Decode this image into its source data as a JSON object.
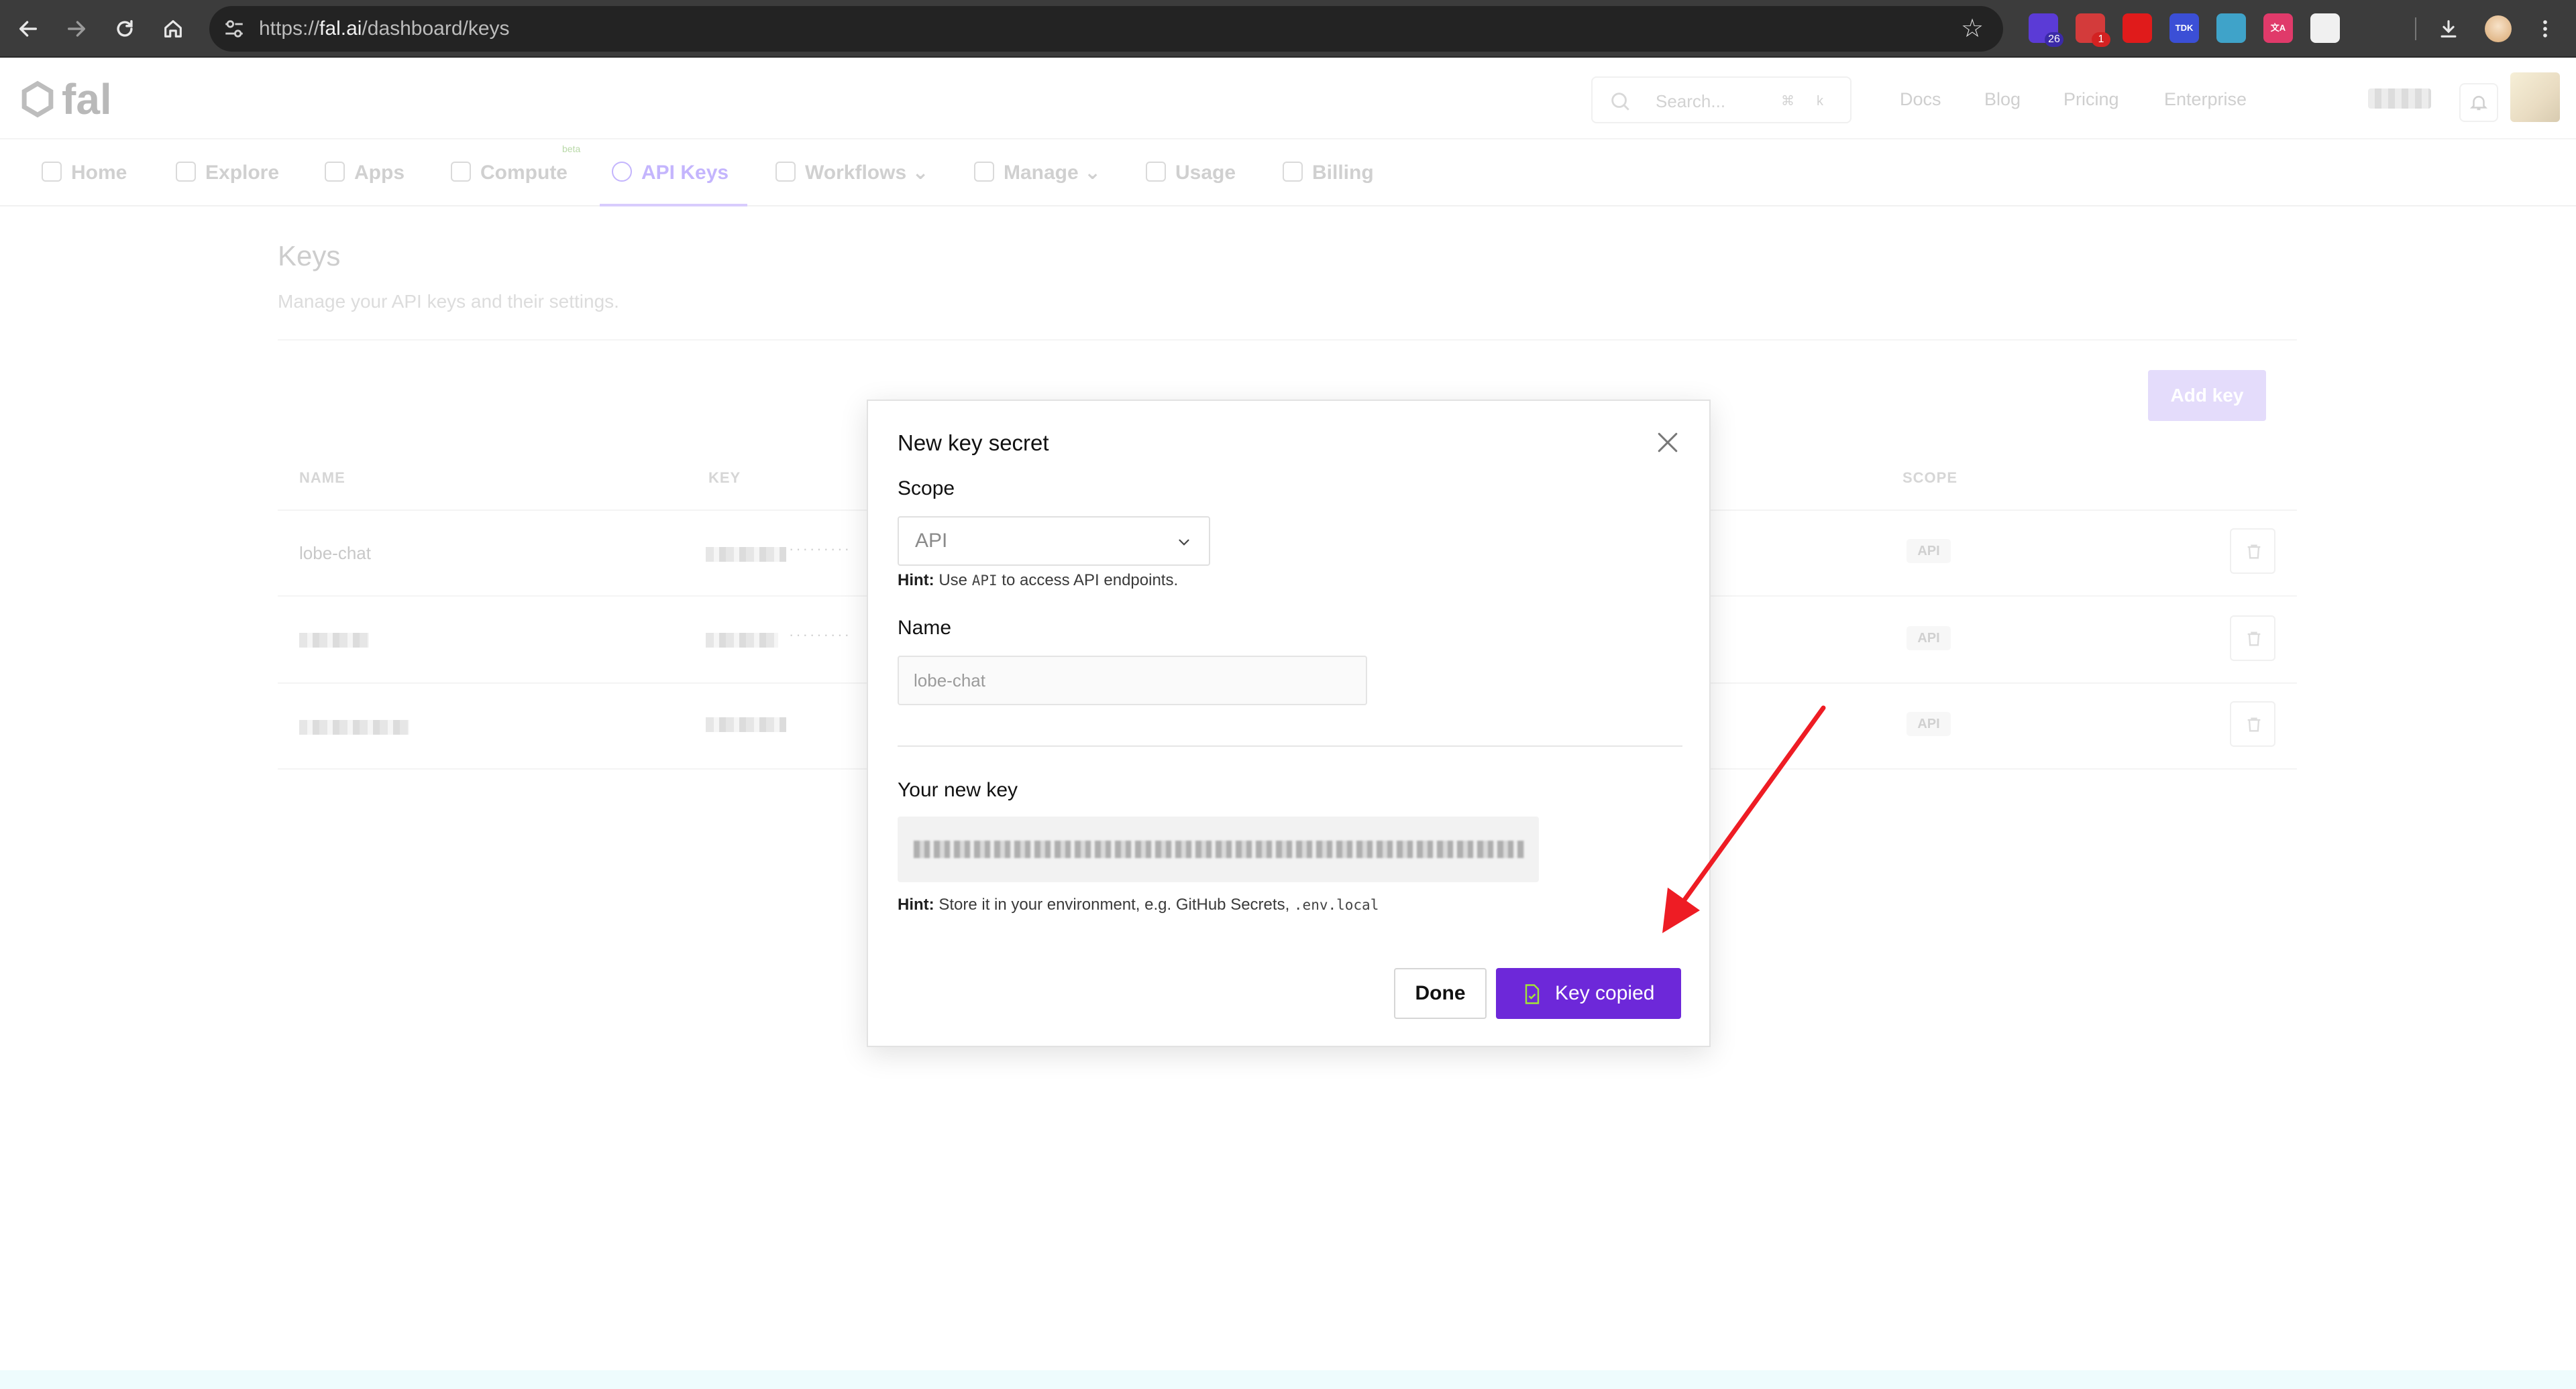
{
  "browser": {
    "url_prefix": "https://",
    "url_host": "fal.ai",
    "url_path": "/dashboard/keys",
    "extensions": [
      {
        "name": "extension-1",
        "badge": "26",
        "color": "#5b3bd6",
        "badge_color": "#3b2aa8"
      },
      {
        "name": "extension-2",
        "badge": "1",
        "color": "#d33b3b",
        "badge_color": "#d32222"
      },
      {
        "name": "extension-3",
        "badge": "",
        "color": "#e01b1b",
        "badge_color": ""
      },
      {
        "name": "extension-4",
        "badge": "",
        "color": "#3b4fd6",
        "badge_color": "",
        "text": "TDK"
      },
      {
        "name": "extension-5",
        "badge": "",
        "color": "#3fa3c9",
        "badge_color": ""
      },
      {
        "name": "extension-6",
        "badge": "",
        "color": "#e03a6a",
        "badge_color": "",
        "text": "文A"
      },
      {
        "name": "extension-7",
        "badge": "",
        "color": "#f0f0f0",
        "badge_color": ""
      }
    ]
  },
  "site": {
    "logo": "fal",
    "search_placeholder": "Search...",
    "search_kbd": [
      "⌘",
      "k"
    ],
    "top_links": [
      "Docs",
      "Blog",
      "Pricing",
      "Enterprise"
    ],
    "tabs": [
      "Home",
      "Explore",
      "Apps",
      "Compute",
      "API Keys",
      "Workflows",
      "Manage",
      "Usage",
      "Billing"
    ],
    "beta_label": "beta",
    "page_title": "Keys",
    "page_subtitle": "Manage your API keys and their settings.",
    "add_key_label": "Add key",
    "table_headers": [
      "NAME",
      "KEY",
      "SCOPE"
    ],
    "rows": [
      {
        "name": "lobe-chat",
        "scope": "API"
      },
      {
        "name": "",
        "scope": "API"
      },
      {
        "name": "",
        "scope": "API"
      }
    ]
  },
  "modal": {
    "title": "New key secret",
    "scope_label": "Scope",
    "scope_value": "API",
    "scope_hint_bold": "Hint:",
    "scope_hint_pre": "Use",
    "scope_hint_code": "API",
    "scope_hint_post": "to access API endpoints.",
    "name_label": "Name",
    "name_value": "lobe-chat",
    "new_key_label": "Your new key",
    "key_hint_bold": "Hint:",
    "key_hint_text": "Store it in your environment, e.g. GitHub Secrets,",
    "key_hint_code": ".env.local",
    "done_label": "Done",
    "copied_label": "Key copied",
    "primary_color": "#6d28d9"
  }
}
